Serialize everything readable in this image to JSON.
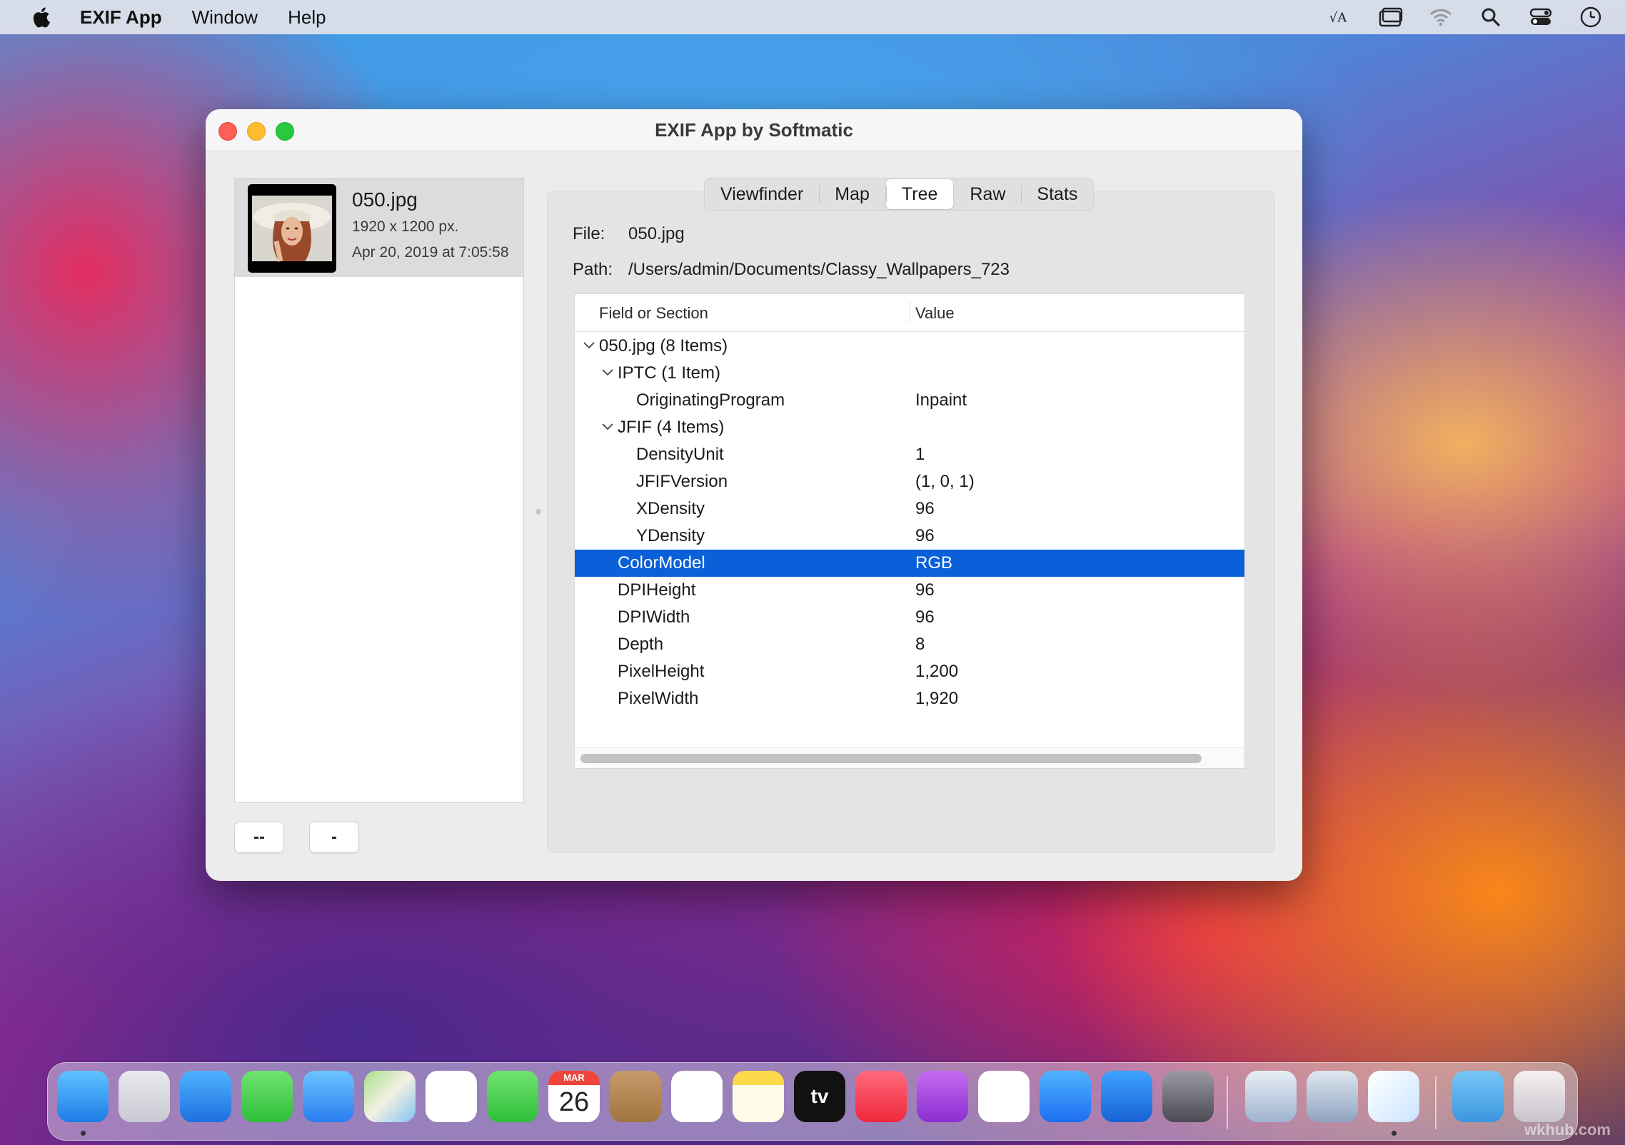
{
  "menubar": {
    "app_name": "EXIF App",
    "items": [
      "Window",
      "Help"
    ],
    "status_icons": [
      "keyboard-input-icon",
      "screen-mirroring-icon",
      "wifi-icon",
      "spotlight-search-icon",
      "control-center-icon",
      "clock-icon"
    ]
  },
  "window": {
    "title": "EXIF App by Softmatic"
  },
  "sidebar": {
    "file": {
      "name": "050.jpg",
      "dimensions": "1920 x 1200 px.",
      "date": "Apr 20, 2019 at 7:05:58"
    },
    "buttons": {
      "add": "--",
      "remove": "-"
    }
  },
  "tabs": [
    {
      "label": "Viewfinder",
      "active": false
    },
    {
      "label": "Map",
      "active": false
    },
    {
      "label": "Tree",
      "active": true
    },
    {
      "label": "Raw",
      "active": false
    },
    {
      "label": "Stats",
      "active": false
    }
  ],
  "info": {
    "file_label": "File:",
    "file_value": "050.jpg",
    "path_label": "Path:",
    "path_value": "/Users/admin/Documents/Classy_Wallpapers_723"
  },
  "table": {
    "headers": [
      "Field or Section",
      "Value"
    ],
    "rows": [
      {
        "name": "050.jpg (8 Items)",
        "value": "",
        "level": 0,
        "expanded": true
      },
      {
        "name": "IPTC (1 Item)",
        "value": "",
        "level": 1,
        "expanded": true
      },
      {
        "name": "OriginatingProgram",
        "value": "Inpaint",
        "level": 2
      },
      {
        "name": "JFIF (4 Items)",
        "value": "",
        "level": 1,
        "expanded": true
      },
      {
        "name": "DensityUnit",
        "value": "1",
        "level": 2
      },
      {
        "name": "JFIFVersion",
        "value": "(1, 0, 1)",
        "level": 2
      },
      {
        "name": "XDensity",
        "value": "96",
        "level": 2
      },
      {
        "name": "YDensity",
        "value": "96",
        "level": 2
      },
      {
        "name": "ColorModel",
        "value": "RGB",
        "level": 1,
        "selected": true
      },
      {
        "name": "DPIHeight",
        "value": "96",
        "level": 1
      },
      {
        "name": "DPIWidth",
        "value": "96",
        "level": 1
      },
      {
        "name": "Depth",
        "value": "8",
        "level": 1
      },
      {
        "name": "PixelHeight",
        "value": "1,200",
        "level": 1
      },
      {
        "name": "PixelWidth",
        "value": "1,920",
        "level": 1
      }
    ]
  },
  "dock": {
    "calendar_month": "MAR",
    "calendar_day": "26",
    "tv_label": "tv",
    "apps": [
      "Finder",
      "Launchpad",
      "Safari",
      "Messages",
      "Mail",
      "Maps",
      "Photos",
      "FaceTime",
      "Calendar",
      "Contacts",
      "Reminders",
      "Notes",
      "TV",
      "Music",
      "Podcasts",
      "News",
      "App Store",
      "Monterey Installer",
      "System Preferences",
      "Preview",
      "Keynote",
      "EXIF App",
      "Downloads",
      "Trash"
    ]
  },
  "watermark": "wkhub.com",
  "colors": {
    "selection": "#0a60d8",
    "close": "#fe5f57",
    "minimize": "#febc2e",
    "zoom": "#28c840"
  }
}
